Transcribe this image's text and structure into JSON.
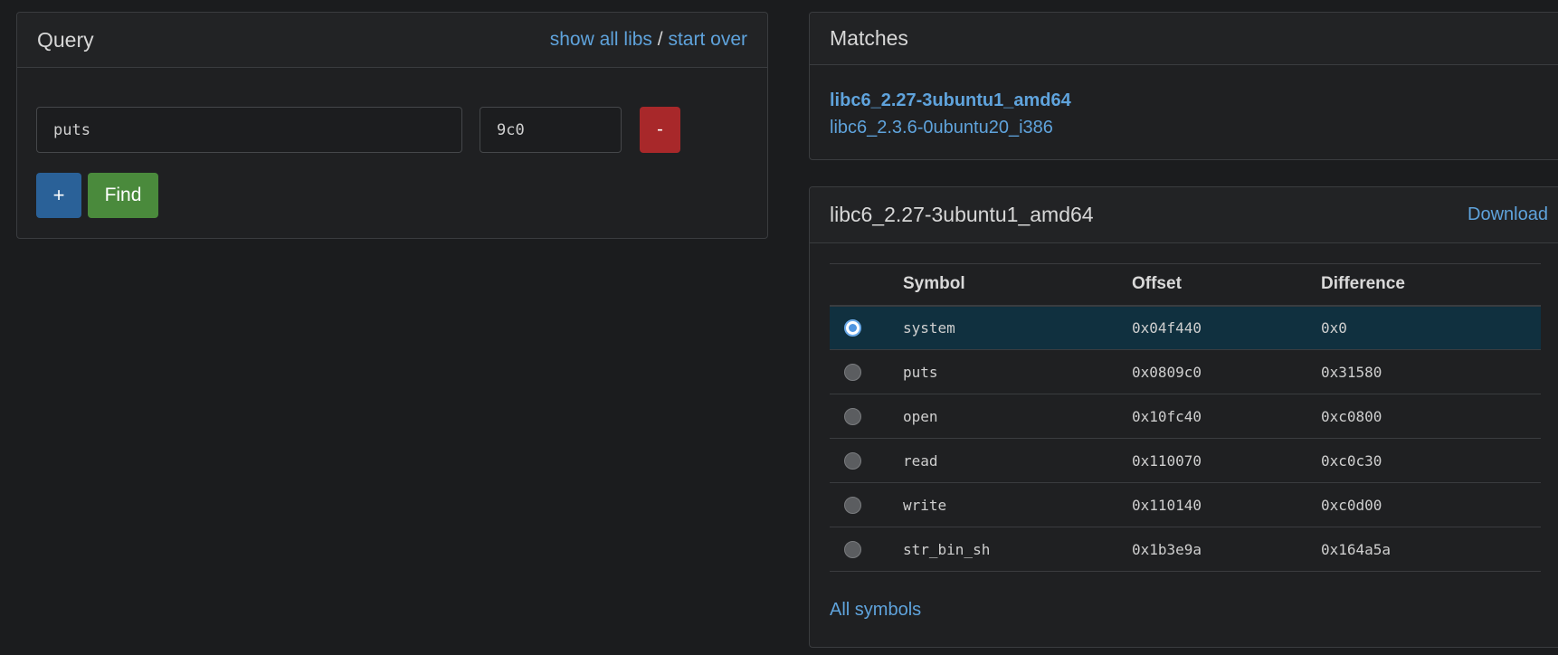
{
  "query": {
    "title": "Query",
    "show_all_libs": "show all libs",
    "separator": "/",
    "start_over": "start over",
    "symbol_value": "puts",
    "offset_value": "9c0",
    "remove_label": "-",
    "add_label": "+",
    "find_label": "Find"
  },
  "matches": {
    "title": "Matches",
    "items": [
      {
        "label": "libc6_2.27-3ubuntu1_amd64",
        "bold": true
      },
      {
        "label": "libc6_2.3.6-0ubuntu20_i386",
        "bold": false
      }
    ]
  },
  "library": {
    "title": "libc6_2.27-3ubuntu1_amd64",
    "download_label": "Download",
    "columns": [
      "",
      "Symbol",
      "Offset",
      "Difference"
    ],
    "rows": [
      {
        "symbol": "system",
        "offset": "0x04f440",
        "difference": "0x0",
        "selected": true
      },
      {
        "symbol": "puts",
        "offset": "0x0809c0",
        "difference": "0x31580",
        "selected": false
      },
      {
        "symbol": "open",
        "offset": "0x10fc40",
        "difference": "0xc0800",
        "selected": false
      },
      {
        "symbol": "read",
        "offset": "0x110070",
        "difference": "0xc0c30",
        "selected": false
      },
      {
        "symbol": "write",
        "offset": "0x110140",
        "difference": "0xc0d00",
        "selected": false
      },
      {
        "symbol": "str_bin_sh",
        "offset": "0x1b3e9a",
        "difference": "0x164a5a",
        "selected": false
      }
    ],
    "all_symbols_label": "All symbols"
  },
  "colors": {
    "link": "#5fa3dc",
    "danger": "#a8282a",
    "primary": "#2a6198",
    "success": "#4a8a3c",
    "selected_row": "#10303f"
  }
}
